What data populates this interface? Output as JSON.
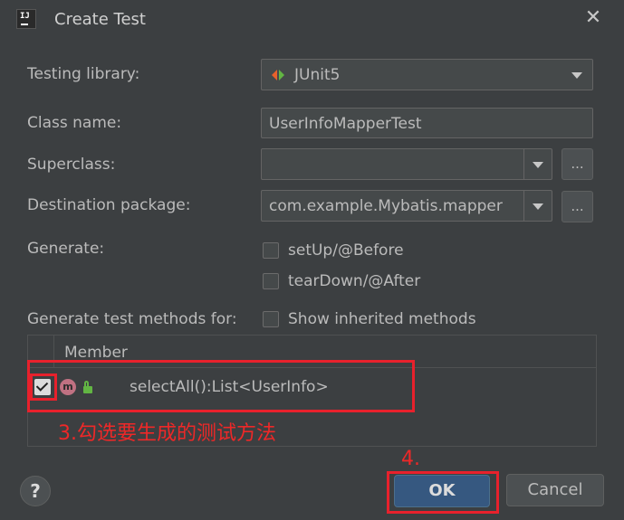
{
  "window": {
    "title": "Create Test",
    "close_icon": "close-icon"
  },
  "form": {
    "testing_library_label": "Testing library:",
    "testing_library_value": "JUnit5",
    "class_name_label": "Class name:",
    "class_name_value": "UserInfoMapperTest",
    "superclass_label": "Superclass:",
    "superclass_value": "",
    "browse_label": "...",
    "destination_label": "Destination package:",
    "destination_value": "com.example.Mybatis.mapper",
    "generate_label": "Generate:",
    "setup_label": "setUp/@Before",
    "teardown_label": "tearDown/@After",
    "methods_label": "Generate test methods for:",
    "inherited_label": "Show inherited methods"
  },
  "table": {
    "header": "Member",
    "rows": [
      {
        "checked": true,
        "name": "selectAll():List<UserInfo>"
      }
    ]
  },
  "annotations": {
    "step3": "3.勾选要生成的测试方法",
    "step4": "4."
  },
  "buttons": {
    "help": "?",
    "ok": "OK",
    "cancel": "Cancel"
  },
  "colors": {
    "accent": "#365880",
    "annotation": "#e8212c",
    "background": "#3c3f41"
  }
}
